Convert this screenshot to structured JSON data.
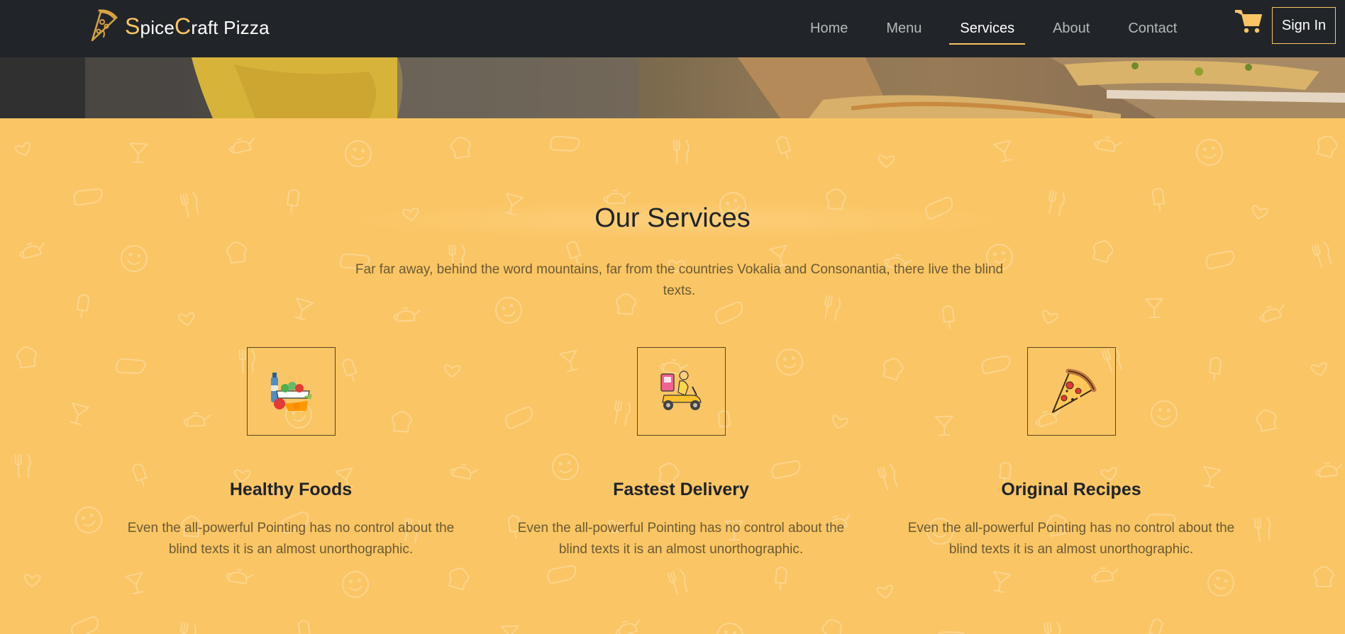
{
  "brand": {
    "cap1": "S",
    "rest1": "pice",
    "cap2": "C",
    "rest2": "raft Pizza",
    "logo_icon": "pizza-slice-logo-icon"
  },
  "nav": {
    "items": [
      {
        "label": "Home",
        "active": false
      },
      {
        "label": "Menu",
        "active": false
      },
      {
        "label": "Services",
        "active": true
      },
      {
        "label": "About",
        "active": false
      },
      {
        "label": "Contact",
        "active": false
      }
    ],
    "cart_icon": "shopping-cart-icon",
    "signin_label": "Sign In"
  },
  "services": {
    "title": "Our Services",
    "subtitle": "Far far away, behind the word mountains, far from the countries Vokalia and Consonantia, there live the blind texts.",
    "cards": [
      {
        "icon": "healthy-food-icon",
        "title": "Healthy Foods",
        "text": "Even the all-powerful Pointing has no control about the blind texts it is an almost unorthographic."
      },
      {
        "icon": "delivery-scooter-icon",
        "title": "Fastest Delivery",
        "text": "Even the all-powerful Pointing has no control about the blind texts it is an almost unorthographic."
      },
      {
        "icon": "pizza-slice-icon",
        "title": "Original Recipes",
        "text": "Even the all-powerful Pointing has no control about the blind texts it is an almost unorthographic."
      }
    ]
  },
  "colors": {
    "accent": "#fac564",
    "navbar_bg": "#212529",
    "section_bg": "#fac564",
    "heading": "#1f2328",
    "body_text": "#6b5a33"
  }
}
